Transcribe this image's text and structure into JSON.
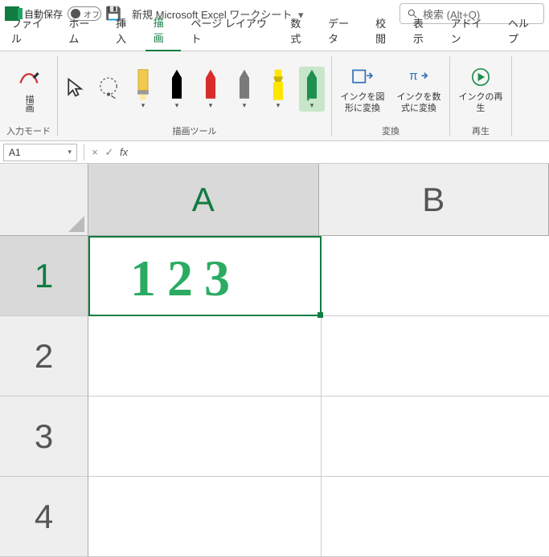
{
  "titlebar": {
    "autosave_label": "自動保存",
    "autosave_state": "オフ",
    "doc_title": "新規 Microsoft Excel ワークシート",
    "search_placeholder": "検索 (Alt+Q)"
  },
  "tabs": {
    "items": [
      "ファイル",
      "ホーム",
      "挿入",
      "描画",
      "ページ レイアウト",
      "数式",
      "データ",
      "校閲",
      "表示",
      "アドイン",
      "ヘルプ"
    ],
    "active_index": 3
  },
  "ribbon": {
    "mode_group_label": "入力モード",
    "draw_btn": "描画",
    "tools_group_label": "描画ツール",
    "pens": [
      {
        "color": "#f2c94c",
        "tip": "#f2c94c",
        "type": "eraser"
      },
      {
        "color": "#000000",
        "tip": "#000000",
        "type": "pen"
      },
      {
        "color": "#d92b2b",
        "tip": "#d92b2b",
        "type": "pen"
      },
      {
        "color": "#7a7a7a",
        "tip": "#7a7a7a",
        "type": "pen"
      },
      {
        "color": "#ffe600",
        "tip": "#ffe600",
        "type": "highlighter"
      },
      {
        "color": "#1f8f4e",
        "tip": "#1f8f4e",
        "type": "pen",
        "active": true
      }
    ],
    "convert_group_label": "変換",
    "ink_to_shape": "インクを図形に変換",
    "ink_to_math": "インクを数式に変換",
    "replay_group_label": "再生",
    "ink_replay": "インクの再生"
  },
  "fx": {
    "namebox": "A1",
    "cancel": "×",
    "confirm": "✓",
    "fx": "fx",
    "value": ""
  },
  "grid": {
    "cols": [
      "A",
      "B"
    ],
    "rows": [
      "1",
      "2",
      "3",
      "4"
    ],
    "selected_cell": "A1",
    "ink_content": "123"
  }
}
